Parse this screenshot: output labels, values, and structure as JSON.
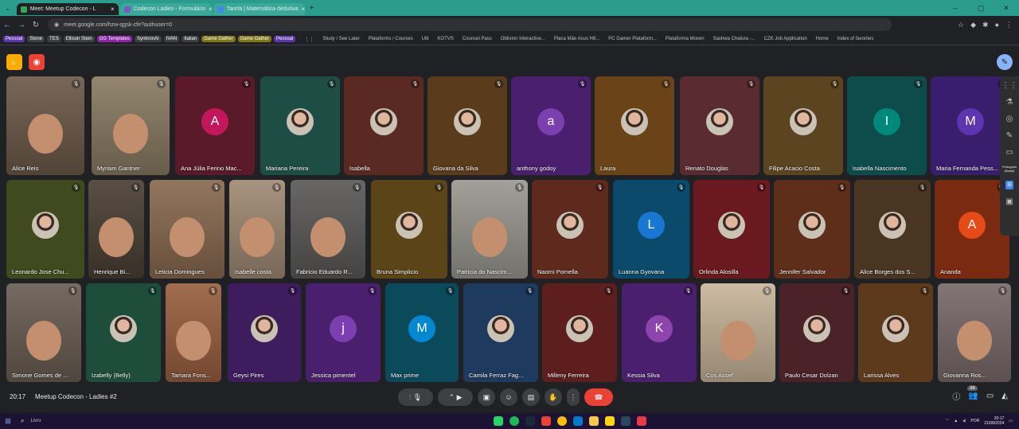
{
  "browser": {
    "tabs": [
      {
        "label": "Meet: Meetup Codecon - L",
        "color": "#34a853",
        "active": true
      },
      {
        "label": "Codecon Ladies - Formulário",
        "color": "#7e57c2",
        "active": false
      },
      {
        "label": "Tarefa | Matemática dedutiva",
        "color": "#4285f4",
        "active": false
      }
    ],
    "url": "meet.google.com/hzw-qgsk-cfe?authuser=0",
    "bookmarks": [
      {
        "label": "Pessoal",
        "color": "#5e35b1"
      },
      {
        "label": "Stone",
        "color": "#3c4043"
      },
      {
        "label": "TES",
        "color": "#3c4043"
      },
      {
        "label": "Ellison Stein",
        "color": "#3c4043"
      },
      {
        "label": "GG Templates",
        "color": "#8e24aa"
      },
      {
        "label": "SynkronAI",
        "color": "#3c4043"
      },
      {
        "label": "IVAN",
        "color": "#3c4043"
      },
      {
        "label": "Italian",
        "color": "#3c4043"
      },
      {
        "label": "Game Gather",
        "color": "#827717"
      },
      {
        "label": "Game Gather",
        "color": "#827717"
      },
      {
        "label": "Pessoal",
        "color": "#5e35b1"
      }
    ],
    "folders": [
      "Study / See Later",
      "Plataforms / Courses",
      "Util",
      "KOTVS",
      "Counsel Pass",
      "Oblivion Interactive...",
      "Placa Mãe Asus H8...",
      "PC Gamer Plataform...",
      "Plataforma Moxen",
      "Sashwa Chatura -...",
      "CZK Job Application",
      "Home",
      "Index of favorites"
    ]
  },
  "meeting": {
    "time": "20:17",
    "title": "Meetup Codecon - Ladies #2",
    "participant_count": "38"
  },
  "tiles": [
    {
      "name": "Alice Reis",
      "kind": "video",
      "bg": "#6d5a4a"
    },
    {
      "name": "Myriam Gantner",
      "kind": "video",
      "bg": "#8a7b63"
    },
    {
      "name": "Ana Júlia Ferino Mac...",
      "kind": "initial",
      "initial": "A",
      "bg": "#5b1a2a",
      "av": "#c2185b"
    },
    {
      "name": "Mariana Pereira",
      "kind": "photo",
      "bg": "#1e4d46"
    },
    {
      "name": "Isabella",
      "kind": "photo",
      "bg": "#5a2a22"
    },
    {
      "name": "Giovana da Silva",
      "kind": "photo",
      "bg": "#5a3c1c"
    },
    {
      "name": "anthony godoy",
      "kind": "initial",
      "initial": "a",
      "bg": "#4a1f6e",
      "av": "#7b3fb0"
    },
    {
      "name": "Laura",
      "kind": "photo",
      "bg": "#6a4418"
    },
    {
      "name": "Renato Douglas",
      "kind": "photo",
      "bg": "#5a2c32"
    },
    {
      "name": "Filipe Acacio Costa",
      "kind": "photo",
      "bg": "#5c4420"
    },
    {
      "name": "Isabella Nascimento",
      "kind": "initial",
      "initial": "I",
      "bg": "#0e4c4c",
      "av": "#00897b"
    },
    {
      "name": "Maria Fernanda Pess...",
      "kind": "initial",
      "initial": "M",
      "bg": "#3a1e6e",
      "av": "#5e35b1"
    },
    {
      "name": "Leonardo Jose Chu...",
      "kind": "photo",
      "bg": "#414a1e"
    },
    {
      "name": "Henrique Bi...",
      "kind": "video",
      "bg": "#4b4034"
    },
    {
      "name": "Leticia Domingues",
      "kind": "video",
      "bg": "#8a6a50"
    },
    {
      "name": "Isabelle costa",
      "kind": "video",
      "bg": "#a08a74"
    },
    {
      "name": "Fabricio Eduardo R...",
      "kind": "video",
      "bg": "#5c5a58"
    },
    {
      "name": "Bruna Simplicio",
      "kind": "photo",
      "bg": "#5a4418"
    },
    {
      "name": "Patricia do Nascim...",
      "kind": "video",
      "bg": "#9a9890"
    },
    {
      "name": "Naomi Pomella",
      "kind": "photo",
      "bg": "#5e2a1e"
    },
    {
      "name": "Luanna Gyovana",
      "kind": "initial",
      "initial": "L",
      "bg": "#0b4a6a",
      "av": "#1976d2"
    },
    {
      "name": "Orlinda Alosilla",
      "kind": "photo",
      "bg": "#6a1a1e"
    },
    {
      "name": "Jennifer Salvador",
      "kind": "photo",
      "bg": "#5e2e1a"
    },
    {
      "name": "Alice Borges dos S...",
      "kind": "photo",
      "bg": "#4a3422"
    },
    {
      "name": "Ananda",
      "kind": "initial",
      "initial": "A",
      "bg": "#7a2a10",
      "av": "#e64a19"
    },
    {
      "name": "Simone Gomes de ...",
      "kind": "video",
      "bg": "#6a5e54"
    },
    {
      "name": "Izabelly (Belly)",
      "kind": "photo",
      "bg": "#1e4d3c"
    },
    {
      "name": "Tamara Fons...",
      "kind": "video",
      "bg": "#9a6040"
    },
    {
      "name": "Geysi Pires",
      "kind": "photo",
      "bg": "#3e1c5e"
    },
    {
      "name": "Jessica pimentel",
      "kind": "initial",
      "initial": "j",
      "bg": "#4a1f6e",
      "av": "#7b3fb0"
    },
    {
      "name": "Max prime",
      "kind": "initial",
      "initial": "M",
      "bg": "#0b4a5a",
      "av": "#0288d1"
    },
    {
      "name": "Camila Ferraz Fag...",
      "kind": "photo",
      "bg": "#1e3a5e"
    },
    {
      "name": "Milleny Ferreira",
      "kind": "photo",
      "bg": "#5e1e1e"
    },
    {
      "name": "Kessia Silva",
      "kind": "initial",
      "initial": "K",
      "bg": "#4a1f6e",
      "av": "#8e44ad"
    },
    {
      "name": "Cos Assef",
      "kind": "video",
      "bg": "#c8b49a"
    },
    {
      "name": "Paulo Cesar Dolzan",
      "kind": "photo",
      "bg": "#4a2228"
    },
    {
      "name": "Larissa Alves",
      "kind": "photo",
      "bg": "#5e3a1c"
    },
    {
      "name": "Giovanna Ros...",
      "kind": "video",
      "bg": "#7a6a6a"
    }
  ],
  "side": {
    "caption": "Português (Brasil)"
  },
  "taskbar": {
    "search": "Livro",
    "lang": "POR",
    "time": "20:17",
    "date": "21/08/2024"
  }
}
